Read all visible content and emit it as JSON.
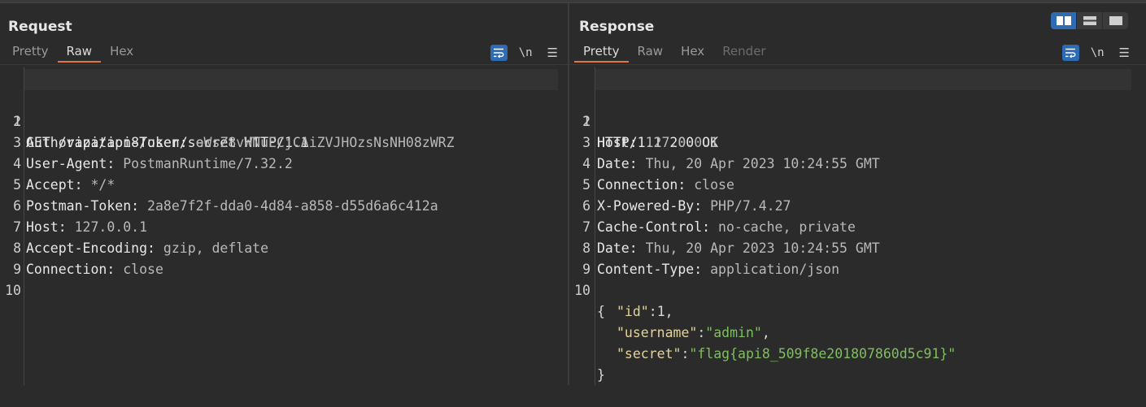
{
  "request": {
    "title": "Request",
    "tabs": [
      "Pretty",
      "Raw",
      "Hex"
    ],
    "active_tab": "Raw",
    "line_numbers": [
      "1",
      "2",
      "3",
      "4",
      "5",
      "6",
      "7",
      "8",
      "9",
      "10"
    ],
    "lines": [
      {
        "key": "GET /vapi/api8/user/secret HTTP/1.1",
        "value": ""
      },
      {
        "key": "Authorization-Token",
        "value": "oWsZ8vWNuECjCAiZVJHOzsNsNH08zWRZ"
      },
      {
        "key": "User-Agent",
        "value": "PostmanRuntime/7.32.2"
      },
      {
        "key": "Accept",
        "value": "*/*"
      },
      {
        "key": "Postman-Token",
        "value": "2a8e7f2f-dda0-4d84-a858-d55d6a6c412a"
      },
      {
        "key": "Host",
        "value": "127.0.0.1"
      },
      {
        "key": "Accept-Encoding",
        "value": "gzip, deflate"
      },
      {
        "key": "Connection",
        "value": "close"
      }
    ],
    "toolbar": {
      "newline_label": "\\n",
      "menu_glyph": "☰"
    }
  },
  "response": {
    "title": "Response",
    "tabs": [
      "Pretty",
      "Raw",
      "Hex",
      "Render"
    ],
    "active_tab": "Pretty",
    "line_numbers": [
      "1",
      "2",
      "3",
      "4",
      "5",
      "6",
      "7",
      "8",
      "9",
      "10"
    ],
    "lines": [
      {
        "key": "HTTP/1.1 200 OK",
        "value": ""
      },
      {
        "key": "Host",
        "value": "127.0.0.1"
      },
      {
        "key": "Date",
        "value": "Thu, 20 Apr 2023 10:24:55 GMT"
      },
      {
        "key": "Connection",
        "value": "close"
      },
      {
        "key": "X-Powered-By",
        "value": "PHP/7.4.27"
      },
      {
        "key": "Cache-Control",
        "value": "no-cache, private"
      },
      {
        "key": "Date",
        "value": "Thu, 20 Apr 2023 10:24:55 GMT"
      },
      {
        "key": "Content-Type",
        "value": "application/json"
      }
    ],
    "json": {
      "open": "{",
      "close": "}",
      "fields": [
        {
          "key": "\"id\"",
          "value": "1",
          "suffix": ","
        },
        {
          "key": "\"username\"",
          "value": "\"admin\"",
          "suffix": ","
        },
        {
          "key": "\"secret\"",
          "value": "\"flag{api8_509f8e201807860d5c91}\"",
          "suffix": ""
        }
      ]
    },
    "toolbar": {
      "newline_label": "\\n",
      "menu_glyph": "☰"
    }
  },
  "colors": {
    "accent_blue": "#2d6bb2",
    "tab_underline": "#e0773f",
    "json_key": "#e3d39a",
    "json_string": "#7fbf5f"
  }
}
